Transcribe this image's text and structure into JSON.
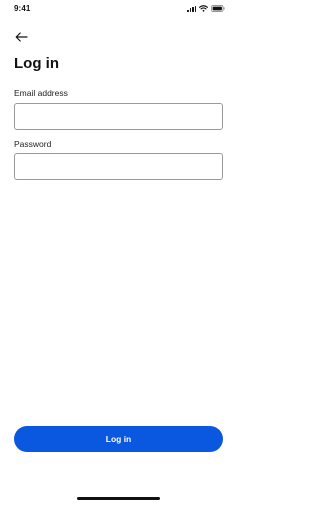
{
  "status_bar": {
    "time": "9:41",
    "icons": [
      "signal-icon",
      "wifi-icon",
      "battery-icon"
    ]
  },
  "header": {
    "back_icon": "arrow-left-icon",
    "title": "Log in"
  },
  "form": {
    "email": {
      "label": "Email address",
      "value": "",
      "placeholder": ""
    },
    "password": {
      "label": "Password",
      "value": "",
      "placeholder": ""
    }
  },
  "actions": {
    "login_label": "Log in"
  },
  "colors": {
    "primary": "#0a57e0",
    "text": "#111111",
    "input_border": "#9a9a9a",
    "background": "#ffffff"
  }
}
